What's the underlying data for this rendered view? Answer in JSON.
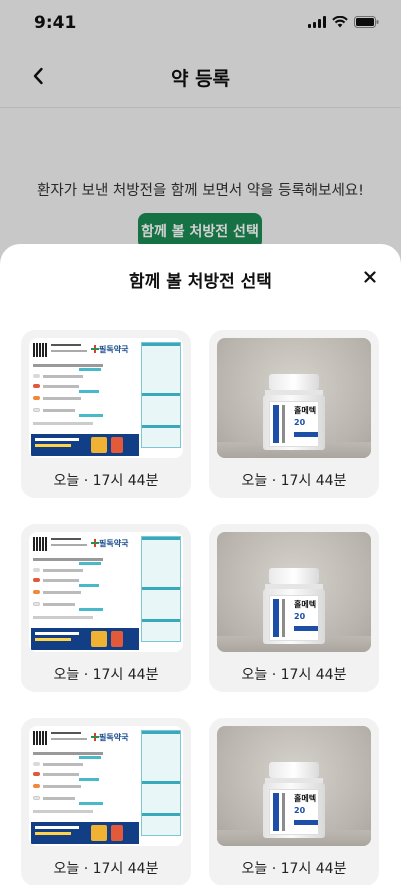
{
  "status_bar": {
    "time": "9:41"
  },
  "nav": {
    "title": "약 등록"
  },
  "page": {
    "intro": "환자가 보낸 처방전을 함께 보면서 약을 등록해보세요!",
    "select_button": "함께 볼 처방전 선택"
  },
  "sheet": {
    "title": "함께 볼 처방전 선택",
    "close": "×",
    "items": [
      {
        "type": "prescription",
        "label": "오늘 · 17시 44분",
        "pharmacy": "필독약국"
      },
      {
        "type": "photo",
        "label": "오늘 · 17시 44분",
        "product": "홀메텍",
        "dose": "20"
      },
      {
        "type": "prescription",
        "label": "오늘 · 17시 44분",
        "pharmacy": "필독약국"
      },
      {
        "type": "photo",
        "label": "오늘 · 17시 44분",
        "product": "홀메텍",
        "dose": "20"
      },
      {
        "type": "prescription",
        "label": "오늘 · 17시 44분",
        "pharmacy": "필독약국"
      },
      {
        "type": "photo",
        "label": "오늘 · 17시 44분",
        "product": "홀메텍",
        "dose": "20"
      }
    ]
  },
  "colors": {
    "accent": "#1c8a55",
    "rx_blue": "#123e86",
    "rx_teal": "#37a9bb"
  }
}
